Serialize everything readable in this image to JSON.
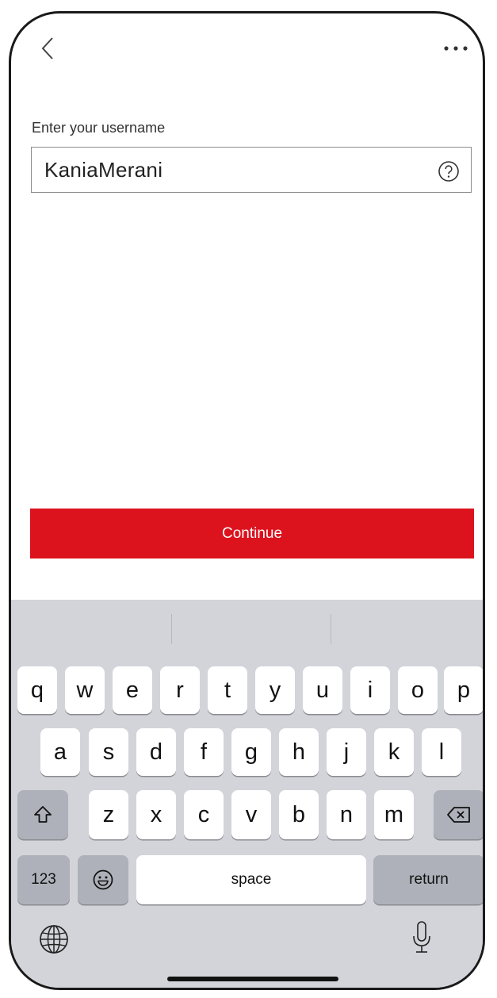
{
  "nav": {
    "back_icon": "chevron-left-icon",
    "more_icon": "more-horizontal-icon"
  },
  "form": {
    "label": "Enter your username",
    "username_value": "KaniaMerani",
    "help_icon": "question-circle-icon"
  },
  "primary_action": {
    "label": "Continue",
    "color": "#dc121d"
  },
  "keyboard": {
    "row1": [
      "q",
      "w",
      "e",
      "r",
      "t",
      "y",
      "u",
      "i",
      "o",
      "p"
    ],
    "row2": [
      "a",
      "s",
      "d",
      "f",
      "g",
      "h",
      "j",
      "k",
      "l"
    ],
    "row3": [
      "z",
      "x",
      "c",
      "v",
      "b",
      "n",
      "m"
    ],
    "shift_icon": "shift-icon",
    "backspace_icon": "backspace-icon",
    "numbers_label": "123",
    "emoji_icon": "emoji-icon",
    "space_label": "space",
    "return_label": "return",
    "globe_icon": "globe-icon",
    "mic_icon": "microphone-icon"
  }
}
